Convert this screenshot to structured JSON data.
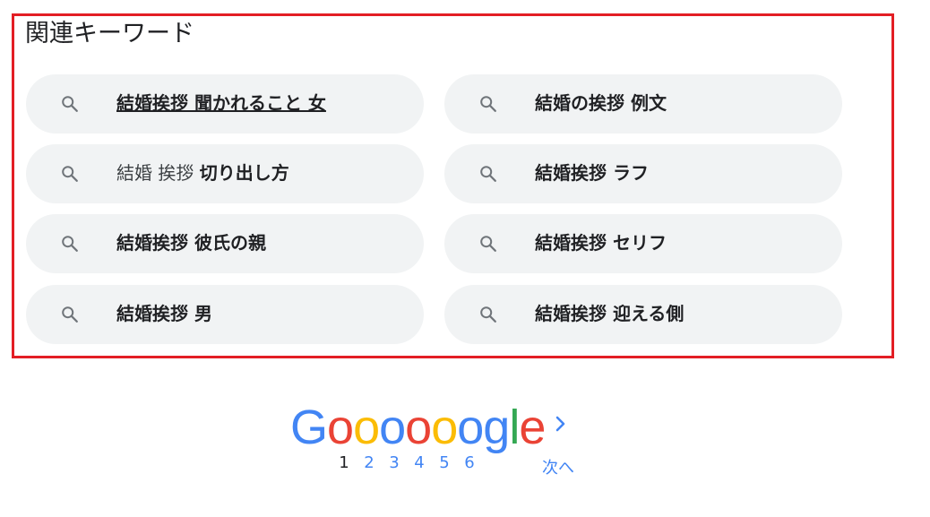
{
  "related": {
    "title": "関連キーワード",
    "items": [
      {
        "prefix": "",
        "bold": "結婚挨拶 聞かれること 女",
        "underlined": true
      },
      {
        "prefix": "",
        "bold": "結婚の挨拶 例文",
        "underlined": false
      },
      {
        "prefix": "結婚 挨拶 ",
        "bold": "切り出し方",
        "underlined": false
      },
      {
        "prefix": "",
        "bold": "結婚挨拶 ラフ",
        "underlined": false
      },
      {
        "prefix": "",
        "bold": "結婚挨拶 彼氏の親",
        "underlined": false
      },
      {
        "prefix": "",
        "bold": "結婚挨拶 セリフ",
        "underlined": false
      },
      {
        "prefix": "",
        "bold": "結婚挨拶 男",
        "underlined": false
      },
      {
        "prefix": "",
        "bold": "結婚挨拶 迎える側",
        "underlined": false
      }
    ],
    "icon": "search-icon",
    "highlight_color": "#e31e24"
  },
  "pagination": {
    "logo_letters": [
      "G",
      "o",
      "o",
      "o",
      "o",
      "o",
      "o",
      "g",
      "l",
      "e"
    ],
    "logo_colors": [
      "#4285f4",
      "#ea4335",
      "#fbbc05",
      "#4285f4",
      "#ea4335",
      "#fbbc05",
      "#4285f4",
      "#4285f4",
      "#34a853",
      "#ea4335"
    ],
    "pages": [
      "1",
      "2",
      "3",
      "4",
      "5",
      "6"
    ],
    "current_page": "1",
    "next_label": "次へ",
    "next_icon": "chevron-right-icon"
  }
}
